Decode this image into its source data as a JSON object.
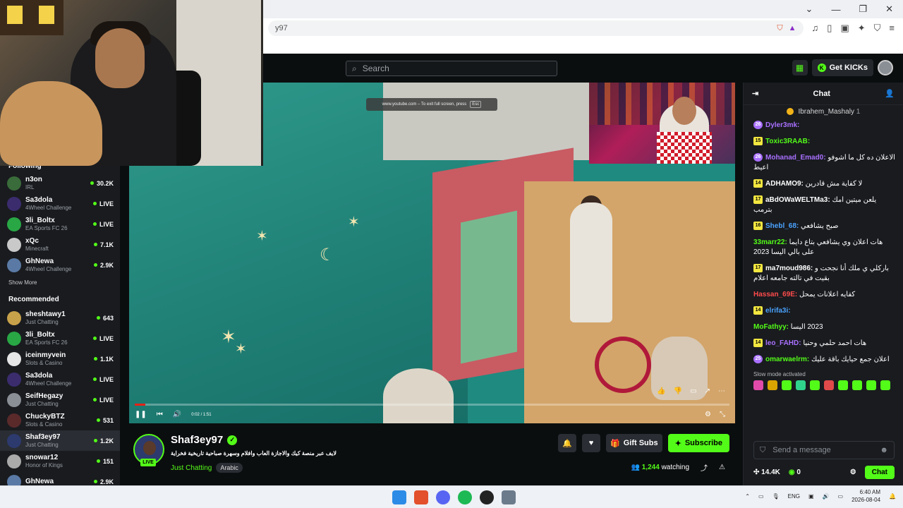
{
  "browser": {
    "url_fragment": "y97",
    "window_controls": [
      "⌄",
      "—",
      "❐",
      "✕"
    ]
  },
  "topbar": {
    "search_placeholder": "Search",
    "get_kicks": "Get KICKs"
  },
  "sidebar": {
    "following_label": "Following",
    "following": [
      {
        "name": "n3on",
        "category": "IRL",
        "status": "30.2K",
        "color": "#3a6b3a"
      },
      {
        "name": "Sa3dola",
        "category": "4Wheel Challenge",
        "status": "LIVE",
        "color": "#3b2c6e"
      },
      {
        "name": "3li_Boltx",
        "category": "EA Sports FC 26",
        "status": "LIVE",
        "color": "#29a745"
      },
      {
        "name": "xQc",
        "category": "Minecraft",
        "status": "7.1K",
        "color": "#c9c9c9"
      },
      {
        "name": "GhNewa",
        "category": "4Wheel Challenge",
        "status": "2.9K",
        "color": "#5a7aa5"
      }
    ],
    "show_more": "Show More",
    "recommended_label": "Recommended",
    "recommended": [
      {
        "name": "sheshtawy1",
        "category": "Just Chatting",
        "status": "643",
        "color": "#c8a24a"
      },
      {
        "name": "3li_Boltx",
        "category": "EA Sports FC 26",
        "status": "LIVE",
        "color": "#29a745"
      },
      {
        "name": "iceinmyvein",
        "category": "Slots & Casino",
        "status": "1.1K",
        "color": "#e6e6e6"
      },
      {
        "name": "Sa3dola",
        "category": "4Wheel Challenge",
        "status": "LIVE",
        "color": "#3b2c6e"
      },
      {
        "name": "SeifHegazy",
        "category": "Just Chatting",
        "status": "LIVE",
        "color": "#8a8f96"
      },
      {
        "name": "ChuckyBTZ",
        "category": "Slots & Casino",
        "status": "531",
        "color": "#5a2a2a"
      },
      {
        "name": "Shaf3ey97",
        "category": "Just Chatting",
        "status": "1.2K",
        "color": "#2c3a6e",
        "active": true
      },
      {
        "name": "snowar12",
        "category": "Honor of Kings",
        "status": "151",
        "color": "#aaaaaa"
      },
      {
        "name": "GhNewa",
        "category": "",
        "status": "2.9K",
        "color": "#5a7aa5"
      }
    ]
  },
  "video": {
    "esc_hint": "www.youtube.com – To exit full screen, press",
    "esc_key": "Esc",
    "time": "0:02 / 1:51",
    "progress_fraction": 0.018
  },
  "stream": {
    "streamer": "Shaf3ey97",
    "live": "LIVE",
    "title": "لايف عبر منصة كيك والاجازة العاب وافلام وسهرة صباحية تاريخية فخراية",
    "category": "Just Chatting",
    "tag": "Arabic",
    "gift_subs": "Gift Subs",
    "subscribe": "Subscribe",
    "viewers": "1,244",
    "watching": "watching"
  },
  "chat": {
    "title": "Chat",
    "pinned_user": "Ibrahem_Mashaly",
    "pinned_count": "1",
    "messages": [
      {
        "badge": "26",
        "badge_type": "purple",
        "user": "Dyler3mk:",
        "color": "#a970ff",
        "text": ""
      },
      {
        "badge": "15",
        "badge_type": "yellow",
        "user": "Toxic3RAAB:",
        "color": "#53fc18",
        "text": ""
      },
      {
        "badge": "26",
        "badge_type": "purple",
        "user": "Mohanad_Emad0:",
        "color": "#a970ff",
        "text": "الاعلان ده كل ما اشوفو اعيط"
      },
      {
        "badge": "14",
        "badge_type": "yellow",
        "user": "ADHAMO9:",
        "color": "#ffffff",
        "text": "لا كفاية مش قادرين"
      },
      {
        "badge": "17",
        "badge_type": "yellow",
        "user": "aBdOWaWELTMa3:",
        "color": "#ffffff",
        "text": "يلعن ميتين امك بترمب"
      },
      {
        "badge": "16",
        "badge_type": "yellow",
        "user": "Shebl_68:",
        "color": "#4aa3ff",
        "text": "صبح يشافعي"
      },
      {
        "badge": "",
        "badge_type": "",
        "user": "33marr22:",
        "color": "#53fc18",
        "text": "هات اعلان وي يشافعي بتاع دايما على بالي اليسا 2023"
      },
      {
        "badge": "17",
        "badge_type": "yellow",
        "user": "ma7moud986:",
        "color": "#ffffff",
        "text": "باركلي ي ملك أنا نجحت و بقيت في تالته جامعه اعلام"
      },
      {
        "badge": "",
        "badge_type": "",
        "user": "Hassan_69E:",
        "color": "#ff4b4b",
        "text": "كفايه اعلانات يمحل"
      },
      {
        "badge": "14",
        "badge_type": "yellow",
        "user": "elrifa3i:",
        "color": "#4aa3ff",
        "text": ""
      },
      {
        "badge": "",
        "badge_type": "",
        "user": "MoFathyy:",
        "color": "#53fc18",
        "text": "2023 اليسا"
      },
      {
        "badge": "14",
        "badge_type": "yellow",
        "user": "leo_FAHD:",
        "color": "#a970ff",
        "text": "هات احمد حلمي وحنيا"
      },
      {
        "badge": "25",
        "badge_type": "purple",
        "user": "omarwaelrm:",
        "color": "#53fc18",
        "text": "اعلان جمع حيايك باقة عليك"
      }
    ],
    "slow_mode": "Slow mode activated",
    "input_placeholder": "Send a message",
    "kicks": "14.4K",
    "points": "0",
    "chat_button": "Chat"
  },
  "taskbar": {
    "lang": "ENG",
    "time": "6:40 AM",
    "date": "2026-08-04"
  }
}
